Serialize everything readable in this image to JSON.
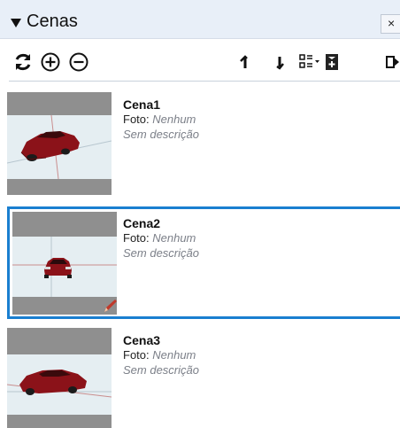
{
  "panel": {
    "title": "Cenas",
    "close_label": "×"
  },
  "toolbar": {
    "buttons": [
      {
        "name": "refresh-icon"
      },
      {
        "name": "add-scene-icon"
      },
      {
        "name": "remove-scene-icon"
      },
      {
        "name": "move-up-icon"
      },
      {
        "name": "move-down-icon"
      },
      {
        "name": "view-options-icon"
      },
      {
        "name": "scene-properties-icon"
      },
      {
        "name": "expand-icon"
      }
    ]
  },
  "scenes": [
    {
      "name": "Cena1",
      "foto_label": "Foto: ",
      "foto_value": "Nenhum",
      "description": "Sem descrição",
      "selected": false
    },
    {
      "name": "Cena2",
      "foto_label": "Foto: ",
      "foto_value": "Nenhum",
      "description": "Sem descrição",
      "selected": true
    },
    {
      "name": "Cena3",
      "foto_label": "Foto: ",
      "foto_value": "Nenhum",
      "description": "Sem descrição",
      "selected": false
    }
  ],
  "colors": {
    "header_bg": "#e8eff8",
    "selection_border": "#1a7fd0",
    "car_red": "#8b1219"
  }
}
